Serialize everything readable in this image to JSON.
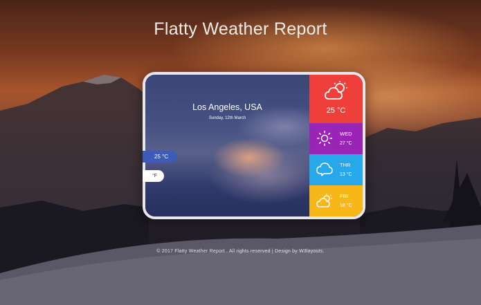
{
  "page": {
    "title": "Flatty Weather Report"
  },
  "location": {
    "city": "Los Angeles, USA",
    "date": "Sunday, 12th March"
  },
  "units": {
    "celsius": "25 °C",
    "fahrenheit": "°F"
  },
  "today": {
    "temp": "25 °C",
    "icon": "partly-cloudy-icon",
    "color": "#ef3f3b"
  },
  "forecast": [
    {
      "day": "WED",
      "temp": "27 °C",
      "icon": "sun-icon",
      "color": "#9a24b5"
    },
    {
      "day": "THR",
      "temp": "13 °C",
      "icon": "cloud-icon",
      "color": "#26a8ea"
    },
    {
      "day": "FRI",
      "temp": "18 °C",
      "icon": "partly-cloudy-icon",
      "color": "#f8b719"
    }
  ],
  "footer": {
    "text": "© 2017 Flatty Weather Report . All rights reserved | Design by W3layouts."
  }
}
